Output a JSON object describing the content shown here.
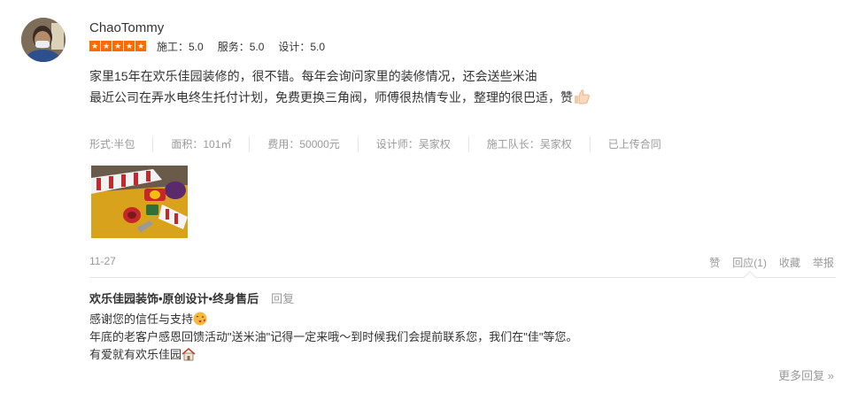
{
  "user": {
    "name": "ChaoTommy"
  },
  "rating": {
    "stars": 5,
    "scores": [
      {
        "label": "施工：5.0"
      },
      {
        "label": "服务：5.0"
      },
      {
        "label": "设计：5.0"
      }
    ]
  },
  "review": {
    "line1": "家里15年在欢乐佳园装修的，很不错。每年会询问家里的装修情况，还会送些米油",
    "line2": "最近公司在弄水电终生托付计划，免费更换三角阀，师傅很热情专业，整理的很巴适，赞",
    "thumb_icon": "thumbs-up-emoji"
  },
  "meta": [
    "形式:半包",
    "面积：101㎡",
    "费用：50000元",
    "设计师：吴家权",
    "施工队长：吴家权",
    "已上传合同"
  ],
  "date": "11-27",
  "actions": {
    "like": "赞",
    "reply": "回应(1)",
    "favorite": "收藏",
    "report": "举报"
  },
  "reply": {
    "name": "欢乐佳园装饰•原创设计•终身售后",
    "label": "回复",
    "line1": "感谢您的信任与支持",
    "line2": "年底的老客户感恩回馈活动\"送米油\"记得一定来哦～到时候我们会提前联系您，我们在\"佳\"等您。",
    "line3": "有爱就有欢乐佳园"
  },
  "more": "更多回复 »",
  "colors": {
    "star": "#ff6a00",
    "muted": "#999999",
    "text": "#333333"
  }
}
